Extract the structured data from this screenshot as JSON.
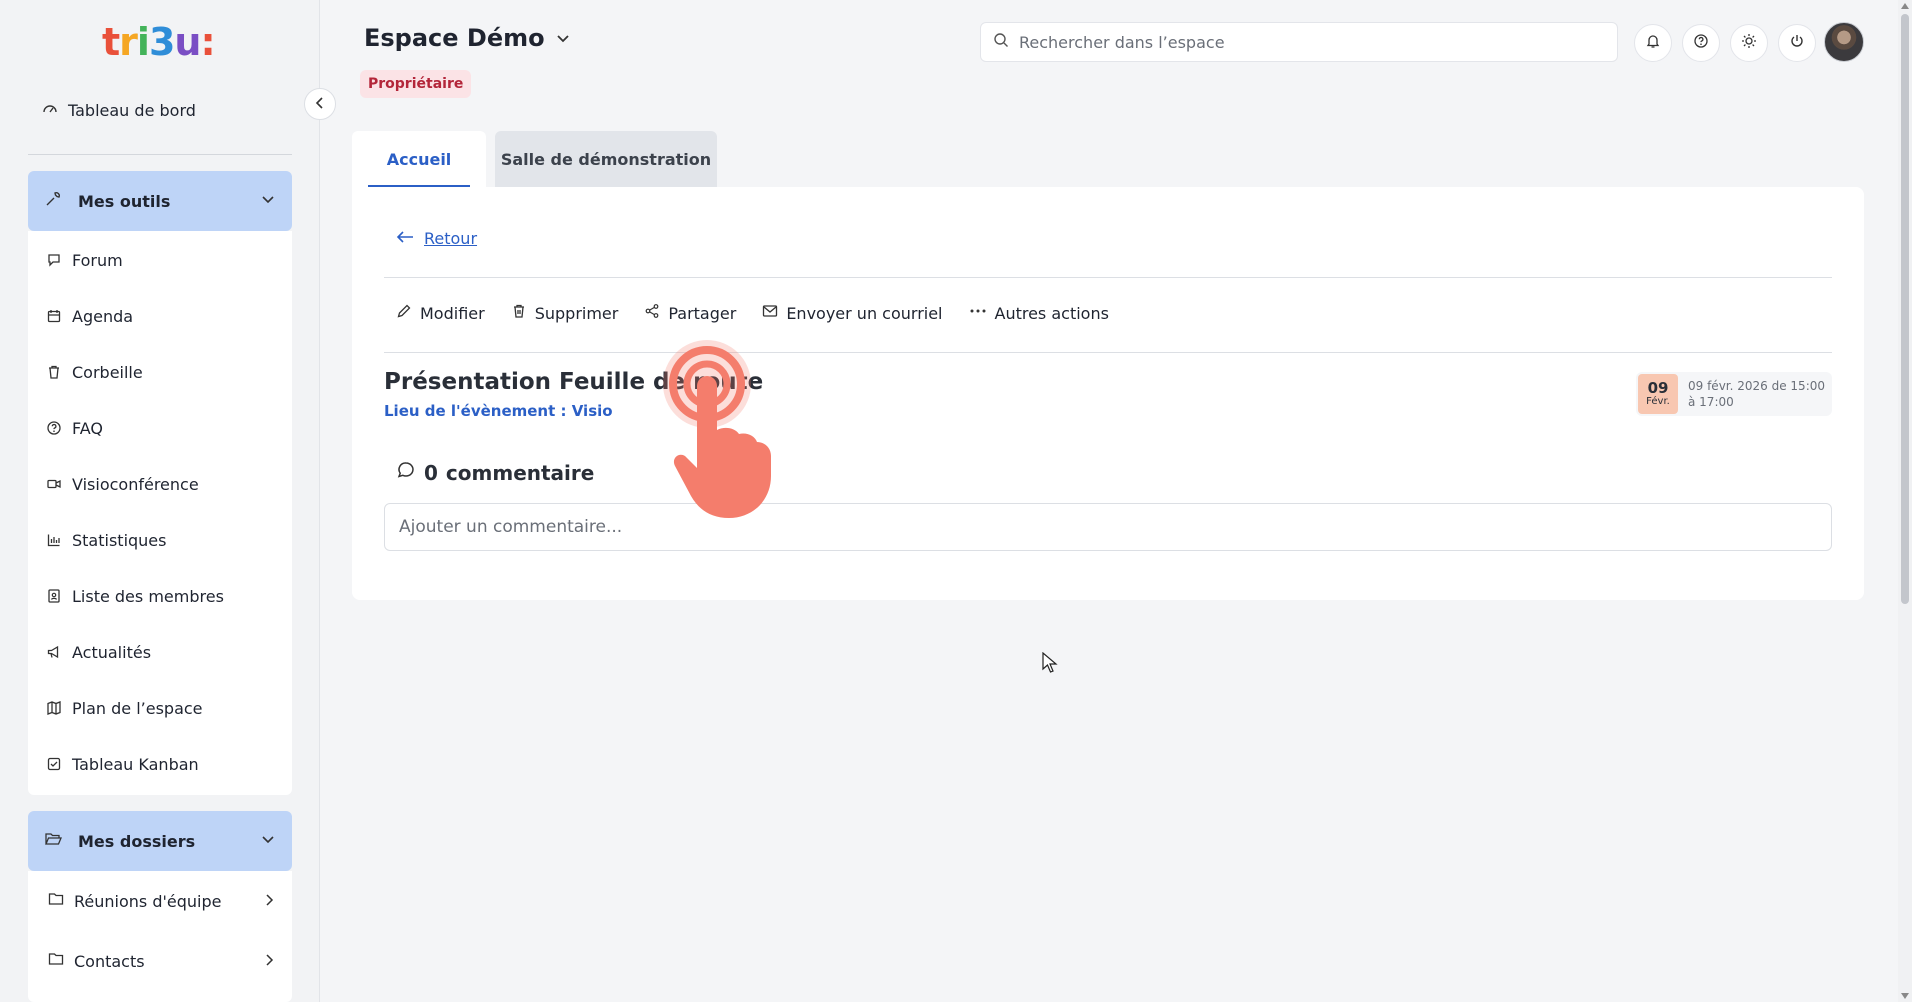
{
  "brand": {
    "logo_text": "tri3u:"
  },
  "sidebar": {
    "dashboard_label": "Tableau de bord",
    "tools_group": {
      "label": "Mes outils",
      "items": [
        {
          "label": "Forum",
          "icon": "forum-icon"
        },
        {
          "label": "Agenda",
          "icon": "calendar-icon"
        },
        {
          "label": "Corbeille",
          "icon": "trash-icon"
        },
        {
          "label": "FAQ",
          "icon": "help-icon"
        },
        {
          "label": "Visioconférence",
          "icon": "video-icon"
        },
        {
          "label": "Statistiques",
          "icon": "stats-icon"
        },
        {
          "label": "Liste des membres",
          "icon": "members-icon"
        },
        {
          "label": "Actualités",
          "icon": "megaphone-icon"
        },
        {
          "label": "Plan de l’espace",
          "icon": "map-icon"
        },
        {
          "label": "Tableau Kanban",
          "icon": "checkbox-icon"
        }
      ]
    },
    "folders_group": {
      "label": "Mes dossiers",
      "items": [
        {
          "label": "Réunions d'équipe"
        },
        {
          "label": "Contacts"
        }
      ]
    }
  },
  "header": {
    "space_title": "Espace Démo",
    "role_badge": "Propriétaire",
    "search_placeholder": "Rechercher dans l’espace"
  },
  "tabs": [
    {
      "label": "Accueil",
      "active": true
    },
    {
      "label": "Salle de démonstration",
      "active": false
    }
  ],
  "event": {
    "back_label": "Retour",
    "actions": {
      "edit": "Modifier",
      "delete": "Supprimer",
      "share": "Partager",
      "email": "Envoyer un courriel",
      "more": "Autres actions"
    },
    "title": "Présentation Feuille de route",
    "location": "Lieu de l'évènement : Visio",
    "date_day": "09",
    "date_month": "Févr.",
    "date_text": "09 févr. 2026 de 15:00 à 17:00",
    "comments_count": "0",
    "comments_label": "commentaire",
    "comment_placeholder": "Ajouter un commentaire..."
  },
  "colors": {
    "accent": "#2b5fc6",
    "group_header_bg": "#bed4f7",
    "badge_bg": "#fbe3e6",
    "badge_text": "#b3263a",
    "tap_indicator": "#f47d6c",
    "date_badge_bg": "#f8c7b1"
  }
}
